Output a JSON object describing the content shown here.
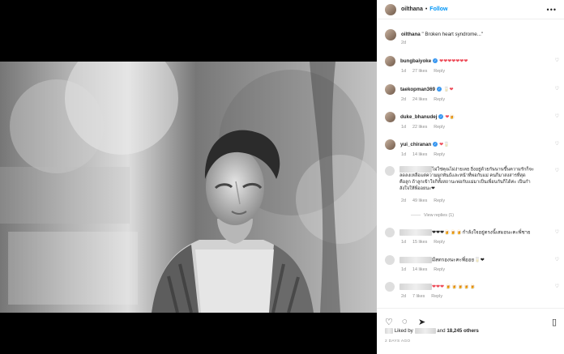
{
  "post": {
    "username": "oilthana",
    "follow_label": "Follow",
    "caption": "\" Broken heart syndrome...\"",
    "time": "2d"
  },
  "comments": [
    {
      "username": "bungbaiyoke",
      "text": "❤❤❤❤❤❤❤",
      "time": "1d",
      "likes": "27 likes",
      "reply": "Reply"
    },
    {
      "username": "taekopman369",
      "text": "🥛❤",
      "time": "2d",
      "likes": "24 likes",
      "reply": "Reply"
    },
    {
      "username": "duke_bhanudej",
      "text": "❤🍺",
      "time": "1d",
      "likes": "22 likes",
      "reply": "Reply"
    },
    {
      "username": "yui_chiranan",
      "text": "❤🥛",
      "time": "1d",
      "likes": "14 likes",
      "reply": "Reply"
    },
    {
      "username": "",
      "text_lines": [
        "ไม่ใช่คุณไม่ง่ายเลย ยิ่งอยู่ด้วยกันนานขึ้นความรักก็จะ",
        "ลดลงเหลือแต่ความผูกพันธ์และหน้าที่พ่อกับแม่ คนก็มาสงสารที่สุด",
        "คือลูก ถ้าลูกเข้าใจก็ทั้งสถานะพ่อกับแม่มาเป็นเพื่อนกันก็ได้ค่ะ เป็นกำ",
        "ลังใจให้พี่ออยนะ❤"
      ],
      "time": "2d",
      "likes": "49 likes",
      "reply": "Reply",
      "view_replies": "View replies (1)"
    },
    {
      "username": "",
      "text": "❤❤❤🍺🍺🍺กำลังใจอยู่ตรงนี้เสมอนะคะพี่ชาย",
      "time": "1d",
      "likes": "15 likes",
      "reply": "Reply"
    },
    {
      "username": "",
      "text": "มีสตรองนะคะพี่ออย🥛❤",
      "time": "1d",
      "likes": "14 likes",
      "reply": "Reply"
    },
    {
      "username": "",
      "text": "❤❤❤ 🍺🍺🍺🍺🍺",
      "time": "2d",
      "likes": "7 likes",
      "reply": "Reply"
    }
  ],
  "footer": {
    "liked_by_prefix": "Liked by",
    "liked_by_suffix": "and",
    "others": "18,245 others",
    "date": "2 DAYS AGO"
  },
  "icons": {
    "more": "more-icon",
    "heart": "heart-icon",
    "comment": "comment-icon",
    "share": "share-icon",
    "bookmark": "bookmark-icon"
  }
}
